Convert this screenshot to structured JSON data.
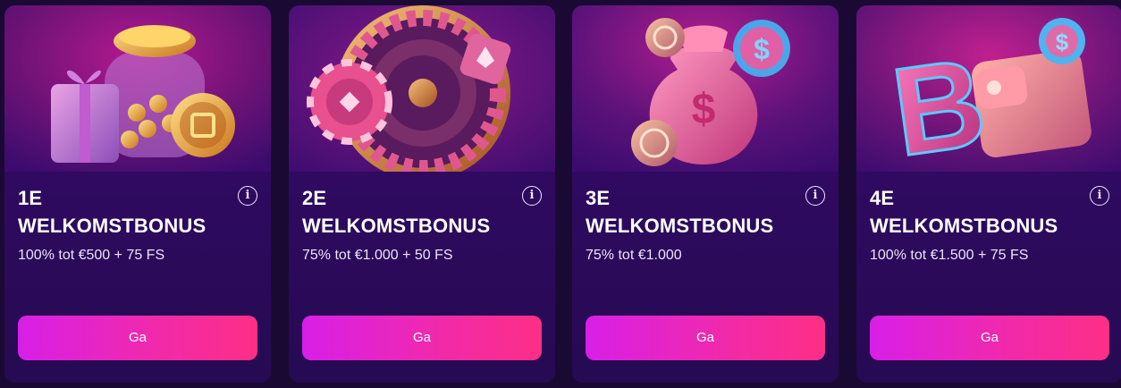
{
  "colors": {
    "page_background": "#1a0a33",
    "card_background": "#2d0a5e",
    "button_gradient_start": "#d81fe8",
    "button_gradient_end": "#fd2f86",
    "text_primary": "#ffffff"
  },
  "bonuses": [
    {
      "title_line1": "1E",
      "title_line2": "WELKOMSTBONUS",
      "offer": "100% tot €500 + 75 FS",
      "button_label": "Ga",
      "info_icon": "info-icon",
      "image": "gift-and-coin-jar"
    },
    {
      "title_line1": "2E",
      "title_line2": "WELKOMSTBONUS",
      "offer": "75% tot €1.000 + 50 FS",
      "button_label": "Ga",
      "info_icon": "info-icon",
      "image": "roulette-wheel"
    },
    {
      "title_line1": "3E",
      "title_line2": "WELKOMSTBONUS",
      "offer": "75% tot €1.000",
      "button_label": "Ga",
      "info_icon": "info-icon",
      "image": "money-bag"
    },
    {
      "title_line1": "4E",
      "title_line2": "WELKOMSTBONUS",
      "offer": "100% tot €1.500 + 75 FS",
      "button_label": "Ga",
      "info_icon": "info-icon",
      "image": "bitcoin-wallet"
    }
  ]
}
